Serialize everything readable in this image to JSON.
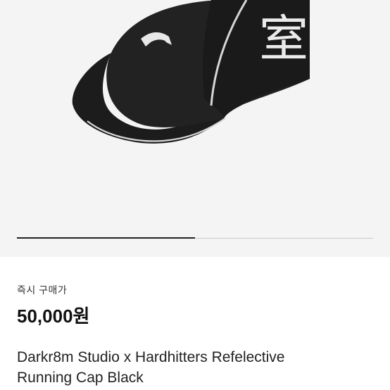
{
  "product": {
    "image_alt": "black running cap",
    "emblem_glyph": "室",
    "carousel": {
      "current_index": 1,
      "total": 2,
      "progress_fraction": 0.5
    }
  },
  "purchase": {
    "label": "즉시 구매가",
    "price": "50,000원"
  },
  "title": {
    "line1": "Darkr8m Studio x Hardhitters Refelective",
    "line2": "Running Cap Black"
  },
  "colors": {
    "cap": "#1e1e1e",
    "reflective_trim": "#d6d6d6",
    "background": "#f4f4f4",
    "indicator": "#222222"
  }
}
